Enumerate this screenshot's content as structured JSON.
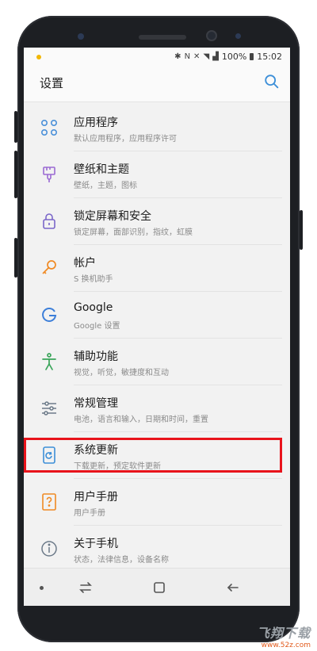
{
  "status_bar": {
    "battery": "100%",
    "time": "15:02"
  },
  "header": {
    "title": "设置"
  },
  "settings": [
    {
      "title": "应用程序",
      "subtitle": "默认应用程序，应用程序许可",
      "icon": "apps-grid-icon"
    },
    {
      "title": "壁纸和主题",
      "subtitle": "壁纸，主题，图标",
      "icon": "paintbrush-icon"
    },
    {
      "title": "锁定屏幕和安全",
      "subtitle": "锁定屏幕，面部识别，指纹，虹膜",
      "icon": "lock-icon"
    },
    {
      "title": "帐户",
      "subtitle": "S 换机助手",
      "icon": "key-icon"
    },
    {
      "title": "Google",
      "subtitle": "Google 设置",
      "icon": "google-icon"
    },
    {
      "title": "辅助功能",
      "subtitle": "视觉，听觉，敏捷度和互动",
      "icon": "accessibility-icon"
    },
    {
      "title": "常规管理",
      "subtitle": "电池，语言和输入，日期和时间，重置",
      "icon": "sliders-icon"
    },
    {
      "title": "系统更新",
      "subtitle": "下载更新，预定软件更新",
      "icon": "system-update-icon"
    },
    {
      "title": "用户手册",
      "subtitle": "用户手册",
      "icon": "user-manual-icon"
    },
    {
      "title": "关于手机",
      "subtitle": "状态，法律信息，设备名称",
      "icon": "info-icon"
    }
  ],
  "watermark": {
    "title": "飞翔下载",
    "url": "www.52z.com"
  },
  "colors": {
    "accent": "#3d8fd8",
    "highlight": "#e8131b",
    "phone": "#1d1f23"
  }
}
